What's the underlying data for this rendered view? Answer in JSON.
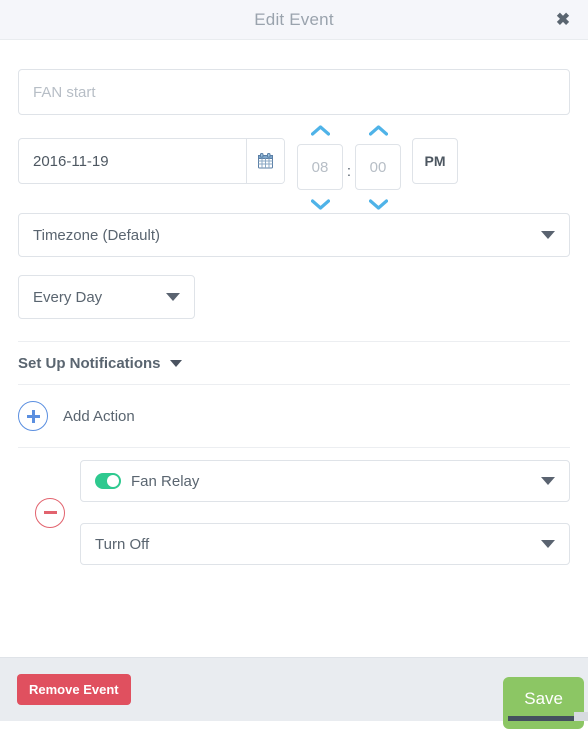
{
  "header": {
    "title": "Edit Event",
    "close_icon": "close-icon",
    "close_glyph": "✖"
  },
  "form": {
    "name": {
      "value": "",
      "placeholder": "FAN start"
    },
    "date": {
      "value": "2016-11-19",
      "calendar_icon": "calendar-icon"
    },
    "time": {
      "hour": "08",
      "minute": "00",
      "separator": ":",
      "meridiem": "PM",
      "hour_up_icon": "chevron-up-icon",
      "hour_down_icon": "chevron-down-icon",
      "minute_up_icon": "chevron-up-icon",
      "minute_down_icon": "chevron-down-icon"
    },
    "timezone": {
      "selected": "Timezone (Default)",
      "caret_icon": "chevron-down-icon"
    },
    "repeat": {
      "selected": "Every Day",
      "caret_icon": "chevron-down-icon"
    },
    "notifications": {
      "label": "Set Up Notifications",
      "chevron_icon": "chevron-down-icon"
    },
    "add_action": {
      "label": "Add Action",
      "icon": "plus-circle-icon"
    }
  },
  "actions": [
    {
      "remove_icon": "minus-circle-icon",
      "device": {
        "label": "Fan Relay",
        "toggle_state": "on",
        "toggle_icon": "toggle-on-icon",
        "caret_icon": "chevron-down-icon"
      },
      "command": {
        "label": "Turn Off",
        "caret_icon": "chevron-down-icon"
      }
    }
  ],
  "footer": {
    "remove_label": "Remove Event",
    "save_label": "Save"
  },
  "colors": {
    "header_bg": "#f5f6fa",
    "accent_blue": "#5b8fe0",
    "danger_red": "#e0505f",
    "success_green": "#8cc664",
    "toggle_green": "#2ec98f",
    "spinner_blue": "#4fb3e8",
    "footer_bg": "#e9ecf0",
    "border": "#dfe3e8",
    "text": "#5a6570"
  }
}
